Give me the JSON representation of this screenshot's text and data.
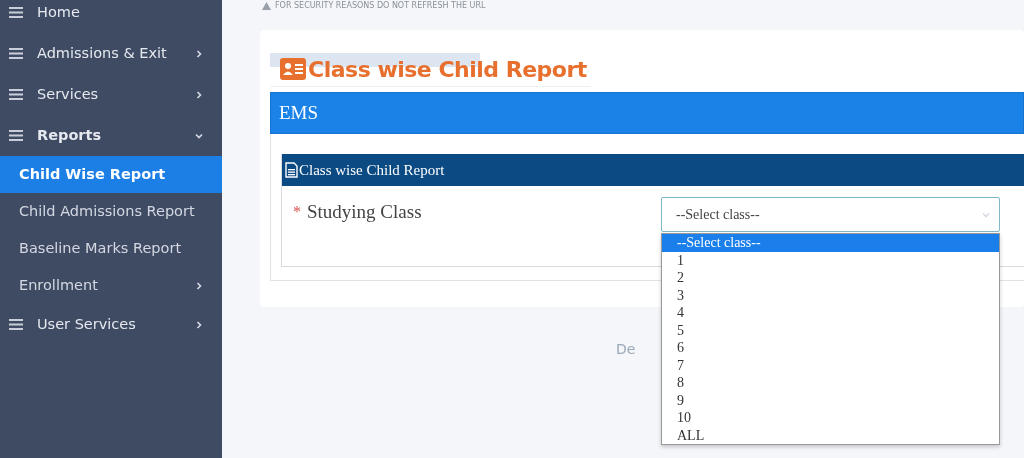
{
  "sidebar": {
    "items": [
      {
        "kind": "section",
        "label": "Home",
        "selected": false
      },
      {
        "kind": "section",
        "label": "Admissions & Exit",
        "selected": false,
        "expanded": false
      },
      {
        "kind": "section",
        "label": "Services",
        "selected": false,
        "expanded": false
      },
      {
        "kind": "section",
        "label": "Reports",
        "selected": false,
        "expanded": true
      },
      {
        "kind": "sub",
        "label": "Child Wise Report",
        "selected": true
      },
      {
        "kind": "sub",
        "label": "Child Admissions Report",
        "selected": false
      },
      {
        "kind": "sub",
        "label": "Baseline Marks Report",
        "selected": false
      },
      {
        "kind": "sub",
        "label": "Enrollment",
        "selected": false,
        "expanded": false
      },
      {
        "kind": "section",
        "label": "User Services",
        "selected": false,
        "expanded": false
      }
    ]
  },
  "notice": "FOR SECURITY REASONS DO NOT REFRESH THE URL",
  "card": {
    "title": "Class wise Child Report",
    "panel_title": "EMS",
    "form": {
      "title": "Class wise Child Report",
      "field": {
        "label": "Studying Class",
        "required_mark": "*",
        "value": "--Select class--",
        "options": [
          {
            "label": "--Select class--",
            "selected": true
          },
          {
            "label": "1",
            "selected": false
          },
          {
            "label": "2",
            "selected": false
          },
          {
            "label": "3",
            "selected": false
          },
          {
            "label": "4",
            "selected": false
          },
          {
            "label": "5",
            "selected": false
          },
          {
            "label": "6",
            "selected": false
          },
          {
            "label": "7",
            "selected": false
          },
          {
            "label": "8",
            "selected": false
          },
          {
            "label": "9",
            "selected": false
          },
          {
            "label": "10",
            "selected": false
          },
          {
            "label": "ALL",
            "selected": false
          }
        ]
      }
    }
  },
  "footer": "De"
}
